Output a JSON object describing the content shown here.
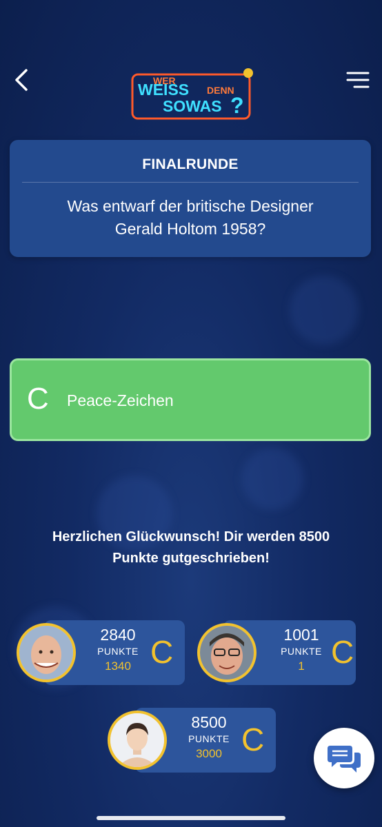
{
  "header": {
    "back_icon": "chevron-left-icon",
    "menu_icon": "hamburger-menu-icon",
    "logo": {
      "line1": "WER",
      "line2": "WEISS",
      "line3": "DENN",
      "line4": "SOWAS",
      "mark": "?"
    }
  },
  "question": {
    "round": "FINALRUNDE",
    "line1": "Was entwarf der britische Designer",
    "line2": "Gerald Holtom 1958?"
  },
  "answer": {
    "letter": "C",
    "text": "Peace-Zeichen",
    "color": "#63c96d"
  },
  "result": {
    "line1": "Herzlichen Glückwunsch! Dir werden 8500",
    "line2": "Punkte gutgeschrieben!"
  },
  "players": [
    {
      "total": "2840",
      "label": "PUNKTE",
      "gain": "1340",
      "answer": "C"
    },
    {
      "total": "1001",
      "label": "PUNKTE",
      "gain": "1",
      "answer": "C"
    },
    {
      "total": "8500",
      "label": "PUNKTE",
      "gain": "3000",
      "answer": "C"
    }
  ],
  "chat": {
    "icon": "chat-bubbles-icon"
  },
  "colors": {
    "background": "#122a63",
    "card": "#234a8e",
    "player_card": "#2d559c",
    "gold": "#f2c22e",
    "correct": "#63c96d"
  }
}
